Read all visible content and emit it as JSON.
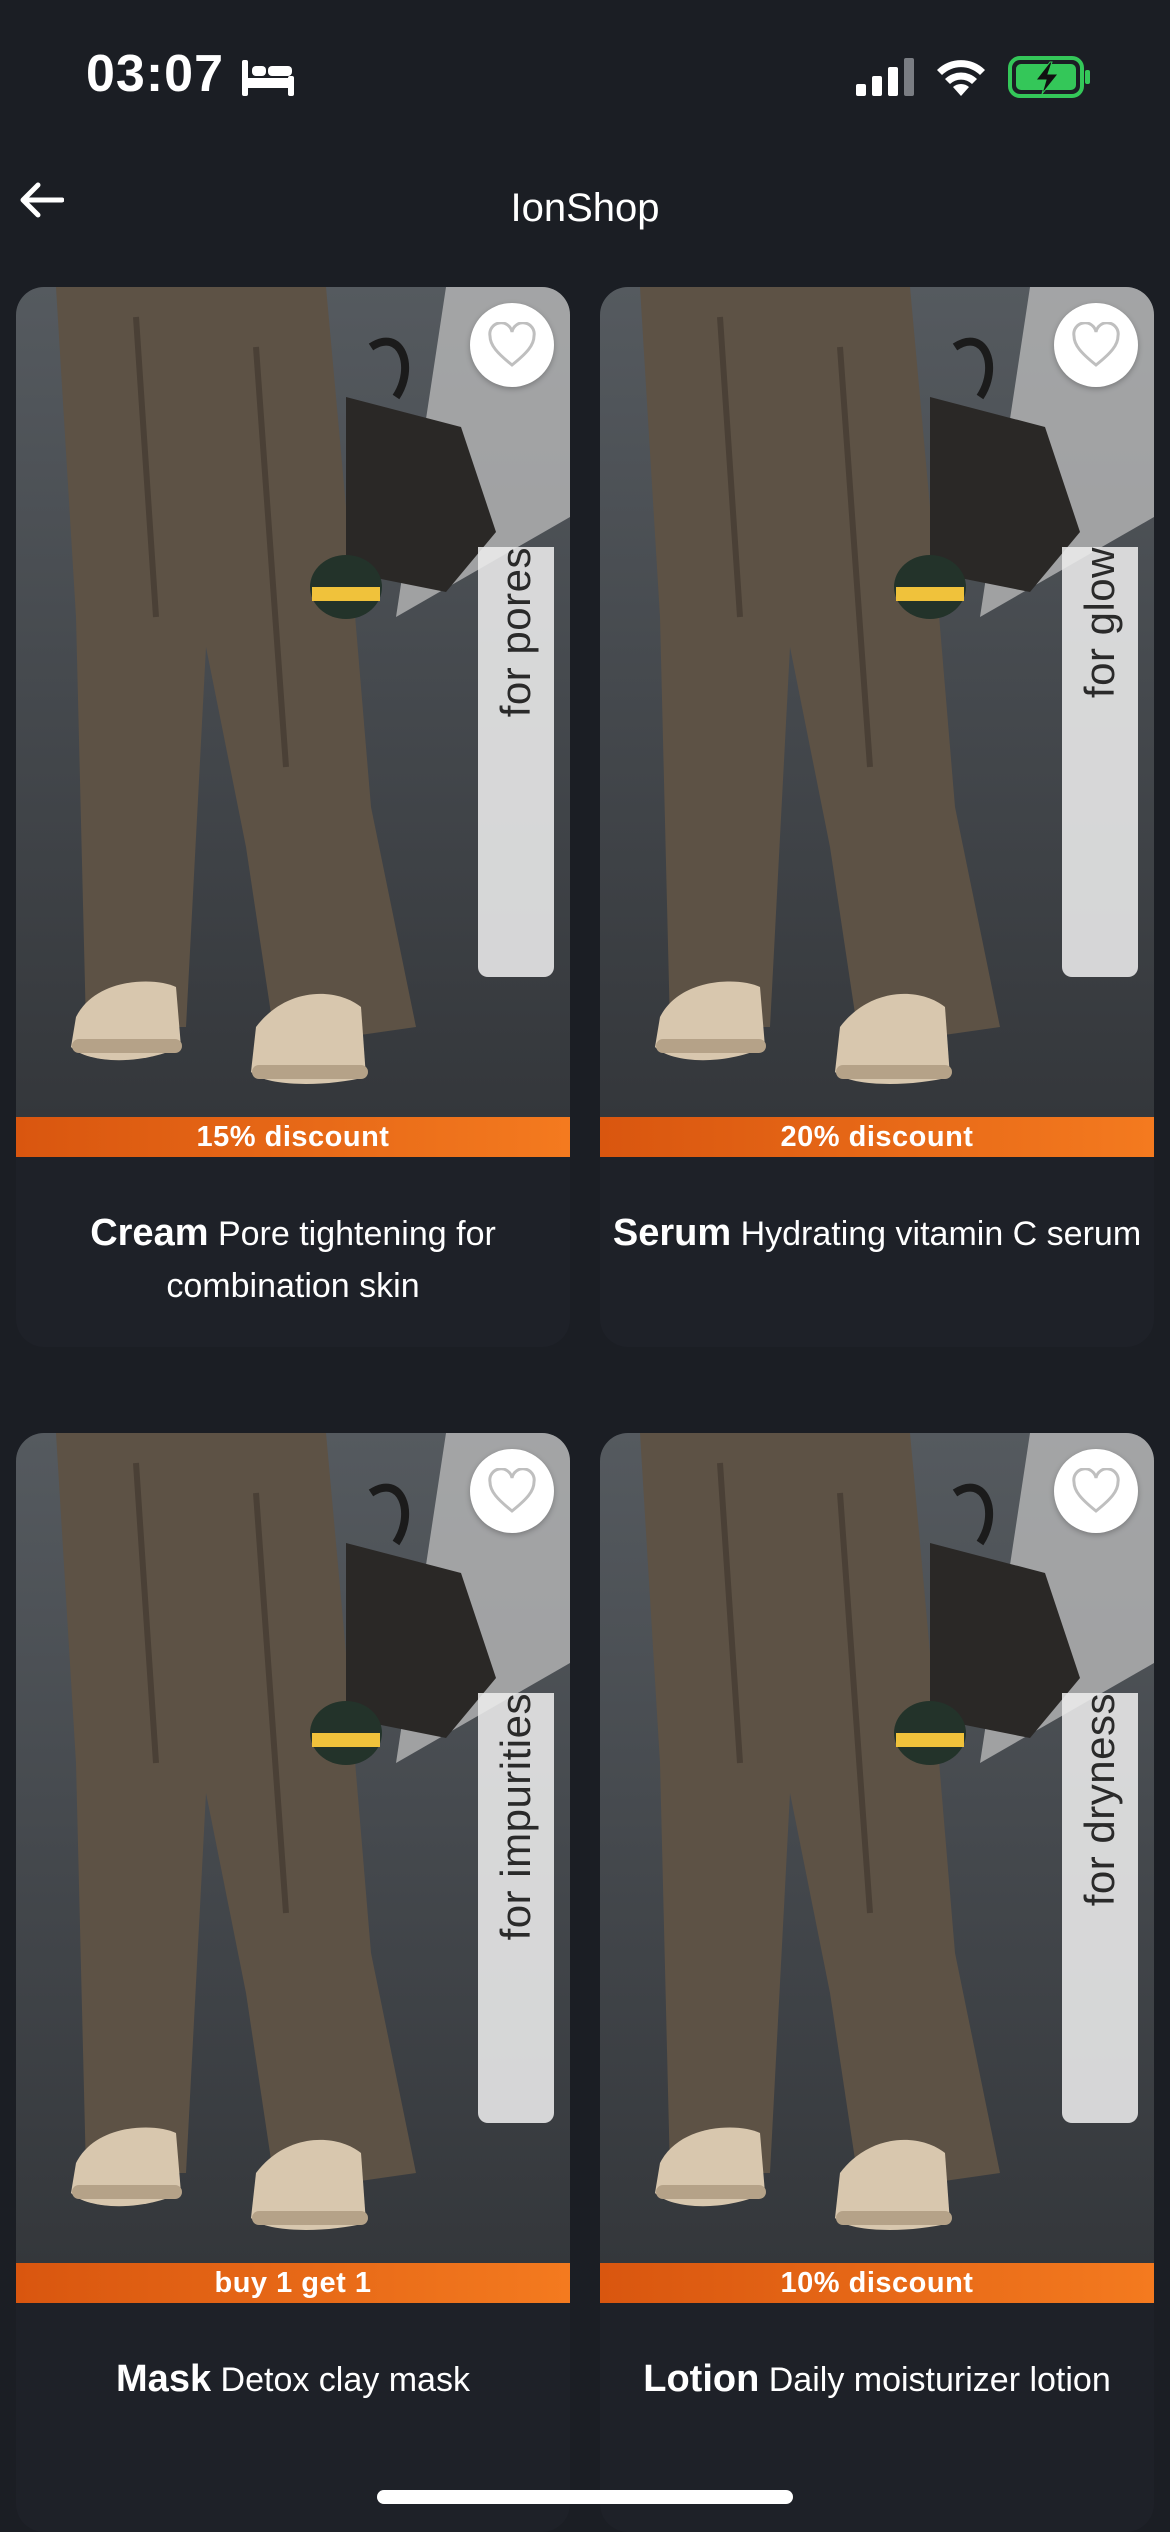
{
  "status_bar": {
    "time": "03:07",
    "icons": [
      "bed-icon",
      "signal-icon",
      "wifi-icon",
      "battery-charging-icon"
    ]
  },
  "nav": {
    "title": "IonShop",
    "back_icon": "arrow-left-icon"
  },
  "colors": {
    "background": "#1b1e24",
    "banner_start": "#d9560f",
    "banner_end": "#f47a1f",
    "battery_green": "#34c759"
  },
  "products": [
    {
      "tag": "for pores",
      "discount": "15% discount",
      "name": "Cream",
      "description": "Pore tightening for combination skin"
    },
    {
      "tag": "for glow",
      "discount": "20% discount",
      "name": "Serum",
      "description": "Hydrating vitamin C serum"
    },
    {
      "tag": "for impurities",
      "discount": "buy 1 get 1",
      "name": "Mask",
      "description": "Detox clay mask"
    },
    {
      "tag": "for dryness",
      "discount": "10% discount",
      "name": "Lotion",
      "description": "Daily moisturizer lotion"
    }
  ]
}
